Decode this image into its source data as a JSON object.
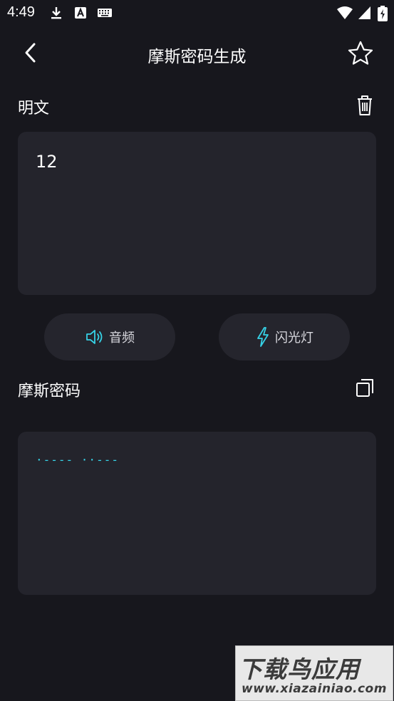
{
  "status_bar": {
    "time": "4:49",
    "icons": [
      "download-icon",
      "font-a-icon",
      "keyboard-icon",
      "wifi-icon",
      "signal-icon",
      "battery-charging-icon"
    ]
  },
  "header": {
    "title": "摩斯密码生成",
    "back_icon": "chevron-left-icon",
    "favorite_icon": "star-outline-icon"
  },
  "plain_section": {
    "label": "明文",
    "input_value": "12",
    "clear_icon": "trash-icon"
  },
  "actions": {
    "audio_label": "音频",
    "flash_label": "闪光灯"
  },
  "morse_section": {
    "label": "摩斯密码",
    "output": "·---- ··---",
    "copy_icon": "copy-icon"
  },
  "watermark": {
    "main": "下载鸟应用",
    "sub": "www.xiazainiao.com"
  },
  "colors": {
    "background": "#17171d",
    "panel": "#24242c",
    "morse_accent": "#36d2e6"
  }
}
